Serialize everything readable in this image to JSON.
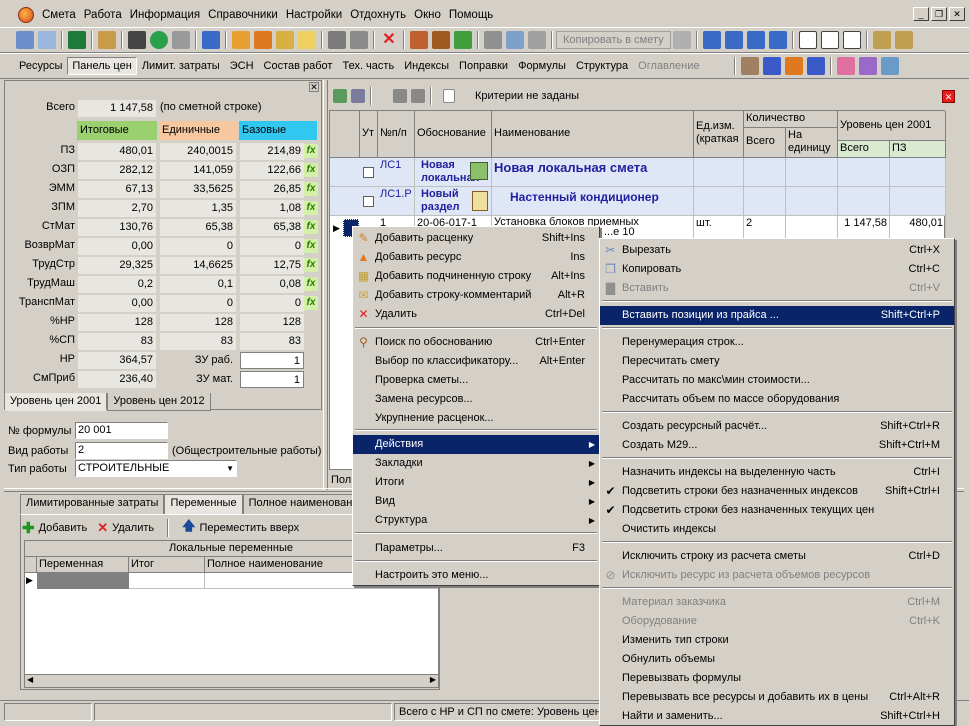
{
  "menubar": {
    "items": [
      "Смета",
      "Работа",
      "Информация",
      "Справочники",
      "Настройки",
      "Отдохнуть",
      "Окно",
      "Помощь"
    ]
  },
  "toolbar1": {
    "copy_to_estimate": "Копировать в смету"
  },
  "toolbar2": {
    "tabs": [
      "Ресурсы",
      "Панель цен",
      "Лимит. затраты",
      "ЭСН",
      "Состав работ",
      "Тех. часть",
      "Индексы",
      "Поправки",
      "Формулы",
      "Структура",
      "Оглавление"
    ]
  },
  "left_panel": {
    "total_label": "Всего",
    "total_value": "1 147,58",
    "total_note": "(по сметной строке)",
    "headers": [
      "Итоговые",
      "Единичные",
      "Базовые"
    ],
    "rows": [
      {
        "label": "ПЗ",
        "v1": "480,01",
        "v2": "240,0015",
        "v3": "214,89",
        "fx": true
      },
      {
        "label": "ОЗП",
        "v1": "282,12",
        "v2": "141,059",
        "v3": "122,66",
        "fx": true
      },
      {
        "label": "ЭММ",
        "v1": "67,13",
        "v2": "33,5625",
        "v3": "26,85",
        "fx": true
      },
      {
        "label": "ЗПМ",
        "v1": "2,70",
        "v2": "1,35",
        "v3": "1,08",
        "fx": true
      },
      {
        "label": "СтМат",
        "v1": "130,76",
        "v2": "65,38",
        "v3": "65,38",
        "fx": true
      },
      {
        "label": "ВозврМат",
        "v1": "0,00",
        "v2": "0",
        "v3": "0",
        "fx": true
      },
      {
        "label": "ТрудСтр",
        "v1": "29,325",
        "v2": "14,6625",
        "v3": "12,75",
        "fx": true
      },
      {
        "label": "ТрудМаш",
        "v1": "0,2",
        "v2": "0,1",
        "v3": "0,08",
        "fx": true
      },
      {
        "label": "ТранспМат",
        "v1": "0,00",
        "v2": "0",
        "v3": "0",
        "fx": true
      },
      {
        "label": "%НР",
        "v1": "128",
        "v2": "128",
        "v3": "128",
        "fx": false
      },
      {
        "label": "%СП",
        "v1": "83",
        "v2": "83",
        "v3": "83",
        "fx": false
      },
      {
        "label": "НР",
        "v1": "364,57",
        "v2": "ЗУ раб.",
        "v3": "1",
        "fx": false
      },
      {
        "label": "СмПриб",
        "v1": "236,40",
        "v2": "ЗУ мат.",
        "v3": "1",
        "fx": false
      }
    ],
    "tabs": [
      "Уровень цен 2001",
      "Уровень цен 2012"
    ]
  },
  "fields": {
    "formula_label": "№ формулы",
    "formula_value": "20 001",
    "work_type_label": "Вид работы",
    "work_type_value": "2",
    "work_type_note": "(Общестроительные работы)",
    "work_kind_label": "Тип работы",
    "work_kind_value": "СТРОИТЕЛЬНЫЕ"
  },
  "grid": {
    "criteria": "Критерии не заданы",
    "headers": {
      "ut": "Ут",
      "num": "№п/п",
      "basis": "Обоснование",
      "name": "Наименование",
      "unit": "Ед.изм. (краткая",
      "qty": "Количество",
      "qty_total": "Всего",
      "qty_per_unit": "На единицу",
      "price_level": "Уровень цен 2001",
      "price_total": "Всего",
      "price_pz": "ПЗ"
    },
    "rows": [
      {
        "num": "ЛС1",
        "basis": "Новая локальная",
        "name": "Новая локальная смета"
      },
      {
        "num": "ЛС1.Р",
        "basis": "Новый раздел",
        "name": "Настенный кондиционер"
      },
      {
        "num": "1",
        "basis": "20-06-017-1",
        "name": "Установка блоков приемных",
        "sub": "...е 10",
        "unit": "шт.",
        "qty": "2",
        "total": "1 147,58",
        "pz": "480,01"
      }
    ],
    "bottom_label": "Пол"
  },
  "bottom_left": {
    "tabs": [
      "Лимитированные затраты",
      "Переменные",
      "Полное наименован"
    ],
    "add": "Добавить",
    "delete": "Удалить",
    "move_up": "Переместить вверх",
    "section_title": "Локальные переменные",
    "cols": [
      "Переменная",
      "Итог",
      "Полное наименование"
    ]
  },
  "statusbar": {
    "text": "Всего с НР и СП по смете: Уровень цен"
  },
  "menu1": {
    "items": [
      {
        "label": "Добавить расценку",
        "shortcut": "Shift+Ins",
        "icon": "add-rate-icon"
      },
      {
        "label": "Добавить ресурс",
        "shortcut": "Ins",
        "icon": "add-resource-icon"
      },
      {
        "label": "Добавить подчиненную строку",
        "shortcut": "Alt+Ins",
        "icon": "add-subrow-icon"
      },
      {
        "label": "Добавить строку-комментарий",
        "shortcut": "Alt+R",
        "icon": "add-comment-icon"
      },
      {
        "label": "Удалить",
        "shortcut": "Ctrl+Del",
        "icon": "delete-icon"
      },
      {
        "label": "Поиск по обоснованию",
        "shortcut": "Ctrl+Enter",
        "icon": "search-icon"
      },
      {
        "label": "Выбор по классификатору...",
        "shortcut": "Alt+Enter"
      },
      {
        "label": "Проверка сметы..."
      },
      {
        "label": "Замена ресурсов..."
      },
      {
        "label": "Укрупнение расценок..."
      },
      {
        "label": "Действия",
        "submenu": true
      },
      {
        "label": "Закладки",
        "submenu": true
      },
      {
        "label": "Итоги",
        "submenu": true
      },
      {
        "label": "Вид",
        "submenu": true
      },
      {
        "label": "Структура",
        "submenu": true
      },
      {
        "label": "Параметры...",
        "shortcut": "F3"
      },
      {
        "label": "Настроить это меню..."
      }
    ]
  },
  "menu2": {
    "items": [
      {
        "label": "Вырезать",
        "shortcut": "Ctrl+X"
      },
      {
        "label": "Копировать",
        "shortcut": "Ctrl+C"
      },
      {
        "label": "Вставить",
        "shortcut": "Ctrl+V"
      },
      {
        "label": "Вставить позиции из прайса  ...",
        "shortcut": "Shift+Ctrl+P"
      },
      {
        "label": "Перенумерация строк..."
      },
      {
        "label": "Пересчитать смету"
      },
      {
        "label": "Рассчитать по макс\\мин стоимости..."
      },
      {
        "label": "Рассчитать объем по массе оборудования"
      },
      {
        "label": "Создать ресурсный расчёт...",
        "shortcut": "Shift+Ctrl+R"
      },
      {
        "label": "Создать М29...",
        "shortcut": "Shift+Ctrl+M"
      },
      {
        "label": "Назначить индексы на выделенную часть",
        "shortcut": "Ctrl+I"
      },
      {
        "label": "Подсветить строки без назначенных индексов",
        "shortcut": "Shift+Ctrl+I"
      },
      {
        "label": "Подсветить строки без назначенных текущих цен"
      },
      {
        "label": "Очистить индексы"
      },
      {
        "label": "Исключить строку из расчета сметы",
        "shortcut": "Ctrl+D"
      },
      {
        "label": "Исключить ресурс из расчета объемов ресурсов"
      },
      {
        "label": "Материал заказчика",
        "shortcut": "Ctrl+M"
      },
      {
        "label": "Оборудование",
        "shortcut": "Ctrl+K"
      },
      {
        "label": "Изменить тип строки"
      },
      {
        "label": "Обнулить объемы"
      },
      {
        "label": "Перевызвать формулы"
      },
      {
        "label": "Перевызвать все ресурсы и добавить их в цены",
        "shortcut": "Ctrl+Alt+R"
      },
      {
        "label": "Найти и заменить...",
        "shortcut": "Shift+Ctrl+H"
      }
    ]
  }
}
